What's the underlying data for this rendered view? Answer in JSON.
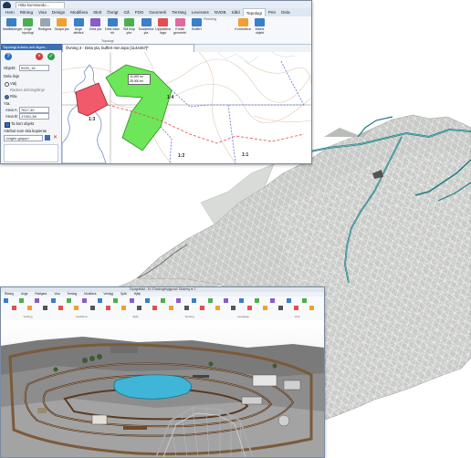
{
  "app_logo": "logo-icon",
  "quick_access": "Hitta kommando...",
  "ribbon_tabs": [
    "Hem",
    "Ritning",
    "Visa",
    "Design",
    "Modifiera",
    "Skrit",
    "Övrigt",
    "Gå",
    "FDO",
    "Geometri",
    "Terräng",
    "Leverans",
    "NVDB",
    "Såld",
    "Topologi",
    "Pen",
    "Dela"
  ],
  "active_tab_index": 14,
  "ribbon_buttons": [
    "Mallåtkomger",
    "Ange topologi",
    "Redigera",
    "Skapa yta",
    "Ange attribut",
    "Dela yta",
    "Dela vase rör",
    "Slå ihop ytor",
    "Sudderera yta",
    "Uppdatera laga",
    "Ersätt geometri",
    "Buffert",
    "Kontrollera",
    "Matrix objekt"
  ],
  "ribbon_group_label": "Topologi",
  "ribbon_extra_label": "Flerkörig",
  "doc_tab": "Övning 3 - Dela yta, buffert mm.topo  [1144467]*",
  "dialog": {
    "title": "Topologi Arbeta och lägnn...",
    "objekt_label": "Objekt:",
    "objekt_value": "9220_16",
    "delalinje_label": "Dela linje",
    "option_valj": "Välj",
    "option_radera": "Radera delningslinje",
    "option_rita": "Rita",
    "yta_label": "Yta:",
    "area_a_label": "Area A:",
    "area_a_value": "7617,30",
    "area_b_label": "Area B:",
    "area_b_value": "17401,38",
    "checkbox_label": "Ta bort objekt",
    "attribut_label": "Attribut som ska kopieras",
    "attribut_select": "<Ingen grupp>"
  },
  "map_labels": {
    "parcel_a": "1:4",
    "parcel_b": "1:3",
    "parcel_c": "1:2",
    "parcel_d": "1:1",
    "tooltip_1": "11.000 m²",
    "tooltip_2": "25.000 m²"
  },
  "bottom_app": {
    "title": "Topografiskt - Ex 3Trackuppbyggnad i Skoberg nr 1",
    "menu": [
      "Ritning",
      "Ange",
      "Redigera",
      "Visa",
      "Terräng",
      "Modifiera",
      "Verktyg",
      "Spår",
      "Hjälp"
    ],
    "group_labels": [
      "Verktyg",
      "Modifiera",
      "Spår",
      "Terräng",
      "Landskap",
      "Visa"
    ]
  },
  "colors": {
    "green_polygon": "#6ee65a",
    "red_polygon": "#f05a6a",
    "boundary_blue": "#6070d0",
    "boundary_red": "#e04848",
    "tin_fill": "#c9cbc8",
    "road_teal": "#1f7c86",
    "water": "#3fb6d8"
  }
}
